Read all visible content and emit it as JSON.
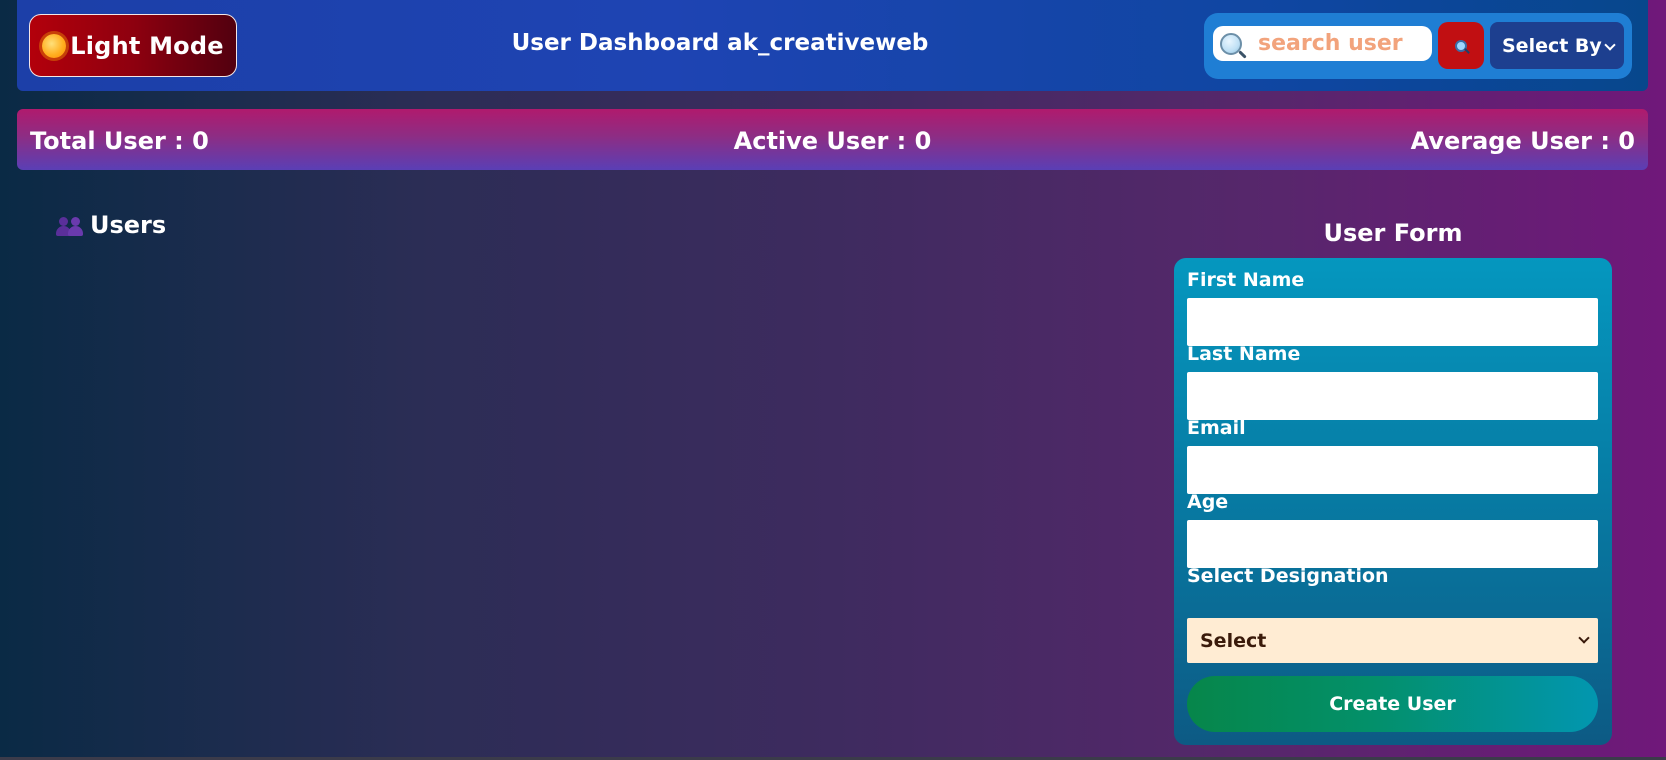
{
  "header": {
    "theme_toggle_label": "Light Mode",
    "title": "User Dashboard ak_creativeweb",
    "search": {
      "placeholder": "search user",
      "value": ""
    },
    "select_by_label": "Select By"
  },
  "stats": {
    "total": "Total User : 0",
    "active": "Active User : 0",
    "average": "Average User : 0"
  },
  "users_section": {
    "heading": "Users",
    "items": []
  },
  "user_form": {
    "title": "User Form",
    "first_name_label": "First Name",
    "last_name_label": "Last Name",
    "email_label": "Email",
    "age_label": "Age",
    "designation_label": "Select Designation",
    "designation_selected": "Select",
    "submit_label": "Create User"
  },
  "colors": {
    "theme_toggle": "#8e000f",
    "search_button": "#c10f12",
    "select_by": "#1d3f8f",
    "designation_select": "#ffecd3",
    "search_placeholder": "#f2a37c"
  }
}
